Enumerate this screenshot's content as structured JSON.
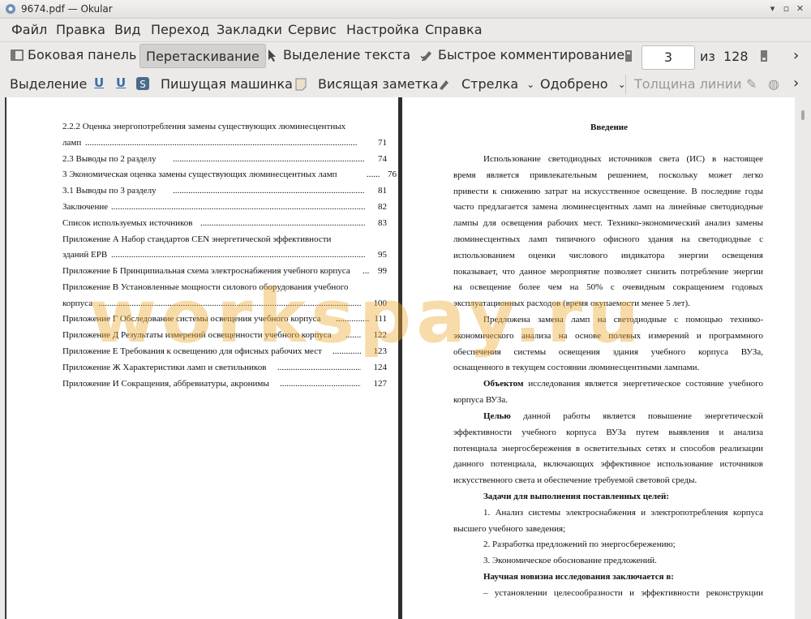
{
  "window": {
    "title": "9674.pdf  — Okular"
  },
  "menu": [
    "Файл",
    "Правка",
    "Вид",
    "Переход",
    "Закладки",
    "Сервис",
    "Настройка",
    "Справка"
  ],
  "toolbar1": {
    "sidebar": "Боковая панель",
    "drag": "Перетаскивание",
    "text_select": "Выделение текста",
    "quick_comment": "Быстрое комментирование",
    "page_current": "3",
    "page_of": "из",
    "page_total": "128",
    "overflow": "›"
  },
  "toolbar2": {
    "select": "Выделение",
    "typewriter": "Пишущая машинка",
    "sticky": "Висящая заметка",
    "arrow": "Стрелка",
    "approved": "Одобрено",
    "line_width": "Толщина линии",
    "overflow": "›"
  },
  "toc": [
    {
      "text": "2.2.2  Оценка энергопотребления замены существующих люминесцентных",
      "page": ""
    },
    {
      "text": "ламп",
      "page": "71"
    },
    {
      "text": "2.3     Выводы по 2 разделу",
      "page": "74"
    },
    {
      "text": "3        Экономическая оценка замены существующих люминесцентных ламп",
      "page": "76"
    },
    {
      "text": "3.1     Выводы по 3 разделу",
      "page": "81"
    },
    {
      "text": "Заключение",
      "page": "82"
    },
    {
      "text": "Список используемых источников",
      "page": "83"
    },
    {
      "text": "Приложение А Набор стандартов CEN энергетической эффективности",
      "page": ""
    },
    {
      "text": "зданий EPB",
      "page": "95"
    },
    {
      "text": "Приложение Б Принципиальная схема электроснабжения учебного корпуса",
      "page": "99"
    },
    {
      "text": "Приложение В Установленные мощности силового оборудования учебного",
      "page": ""
    },
    {
      "text": "корпуса",
      "page": "100"
    },
    {
      "text": "Приложение Г Обследование системы освещения учебного корпуса",
      "page": "111"
    },
    {
      "text": "Приложение Д Результаты измерений освещенности учебного корпуса",
      "page": "122"
    },
    {
      "text": "Приложение Е Требования к освещению для офисных рабочих мест",
      "page": "123"
    },
    {
      "text": "Приложение Ж Характеристики ламп и светильников",
      "page": "124"
    },
    {
      "text": "Приложение И Сокращения, аббревиатуры, акронимы",
      "page": "127"
    }
  ],
  "right_page": {
    "heading": "Введение",
    "p1": [
      "Использование светодиодных источников света (ИС) в настоящее",
      "время является привлекательным решением, поскольку может легко",
      "привести к снижению затрат на искусственное освещение. В последние годы",
      "часто предлагается замена люминесцентных ламп на линейные светодиодные",
      "лампы для освещения рабочих мест. Технико-экономический анализ замены",
      "люминесцентных ламп типичного офисного здания на светодиодные с",
      "использованием оценки числового индикатора энергии освещения",
      "показывает, что данное мероприятие позволяет снизить потребление энергии",
      "на освещение более чем на 50% с очевидным сокращением годовых",
      "эксплуатационных расходов (время окупаемости менее 5 лет)."
    ],
    "p2": [
      "Предложена замена ламп на светодиодные с помощью технико-",
      "экономического анализа на основе полевых измерений и программного",
      "обеспечения системы освещения здания учебного корпуса ВУЗа,",
      "осна­щенного в текущем состоянии люминесцентными лампами."
    ],
    "object_label": "Объектом",
    "object_rest": "исследования является энергетическое состояние учебного",
    "object_line2": "корпуса ВУЗа.",
    "goal_label": "Целью",
    "goal_rest": "данной работы является повышение энергетической",
    "goal_lines": [
      "эффективности учебного корпуса ВУЗа путем выявления и анализа",
      "потенциала энергосбережения в осветительных сетях и способов реализации",
      "данного потенциала, включающих эффективное использование источников",
      "искусственного света и обеспечение требуемой световой среды."
    ],
    "tasks_heading": "Задачи для выполнения поставленных целей:",
    "task1a": "1. Анализ системы электроснабжения и электропотребления корпуса",
    "task1b": "высшего учебного заведения;",
    "task2": "2. Разработка предложений по энергосбережению;",
    "task3": "3. Экономическое обоснование предложений.",
    "novelty_heading": "Научная новизна исследования заключается в:",
    "novelty1": "– установлении целесообразности и эффективности реконструкции"
  },
  "watermark": "workspay.ru"
}
